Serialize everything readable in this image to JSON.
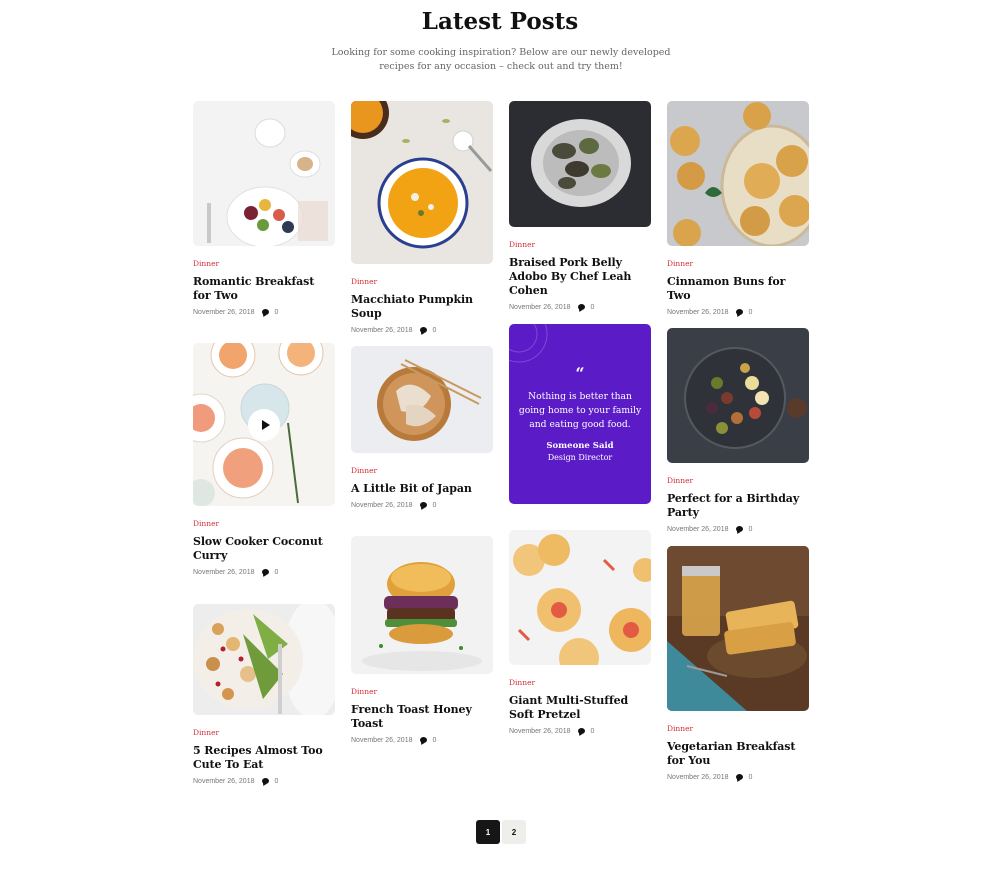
{
  "header": {
    "title": "Latest Posts",
    "subtitle": "Looking for some cooking inspiration? Below are our newly developed recipes for any occasion – check out and try them!"
  },
  "posts": [
    {
      "category": "Dinner",
      "title": "Romantic Breakfast for Two",
      "date": "November 26, 2018",
      "comments": "0"
    },
    {
      "category": "Dinner",
      "title": "Slow Cooker Coconut Curry",
      "date": "November 26, 2018",
      "comments": "0"
    },
    {
      "category": "Dinner",
      "title": "5 Recipes Almost Too Cute To Eat",
      "date": "November 26, 2018",
      "comments": "0"
    },
    {
      "category": "Dinner",
      "title": "Macchiato Pumpkin Soup",
      "date": "November 26, 2018",
      "comments": "0"
    },
    {
      "category": "Dinner",
      "title": "A Little Bit of Japan",
      "date": "November 26, 2018",
      "comments": "0"
    },
    {
      "category": "Dinner",
      "title": "French Toast Honey Toast",
      "date": "November 26, 2018",
      "comments": "0"
    },
    {
      "category": "Dinner",
      "title": "Braised Pork Belly Adobo By Chef Leah Cohen",
      "date": "November 26, 2018",
      "comments": "0"
    },
    {
      "category": "Dinner",
      "title": "Giant Multi-Stuffed Soft Pretzel",
      "date": "November 26, 2018",
      "comments": "0"
    },
    {
      "category": "Dinner",
      "title": "Cinnamon Buns for Two",
      "date": "November 26, 2018",
      "comments": "0"
    },
    {
      "category": "Dinner",
      "title": "Perfect for a Birthday Party",
      "date": "November 26, 2018",
      "comments": "0"
    },
    {
      "category": "Dinner",
      "title": "Vegetarian Breakfast for You",
      "date": "November 26, 2018",
      "comments": "0"
    }
  ],
  "quote": {
    "mark": "“",
    "text": "Nothing is better than going home to your family and eating good food.",
    "author": "Someone Said",
    "role": "Design Director"
  },
  "pagination": {
    "page1": "1",
    "page2": "2"
  },
  "colors": {
    "accent_category": "#d0303a",
    "quote_bg": "#5b1cc8",
    "active_page": "#161616"
  },
  "icons": {
    "comment": "comment-icon",
    "play": "play-icon",
    "quote": "quote-icon"
  }
}
